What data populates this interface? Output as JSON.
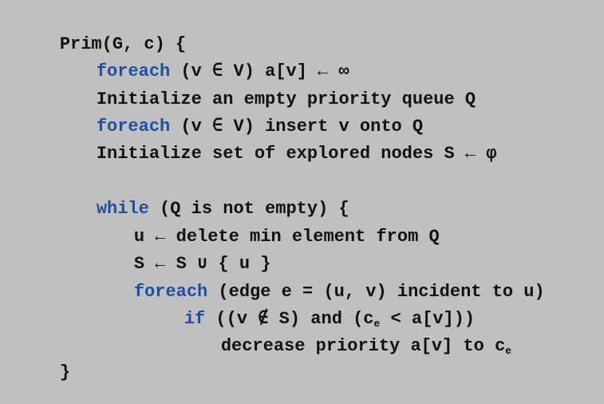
{
  "colors": {
    "background": "#c0c0c0",
    "text": "#111111",
    "keyword": "#1f4fa0"
  },
  "code": {
    "l1": {
      "text": "Prim(G, c) {"
    },
    "l2": {
      "kw": "foreach",
      "text": " (v ∈ V) a[v] ← ∞"
    },
    "l3": {
      "text": "Initialize an empty priority queue Q"
    },
    "l4": {
      "kw": "foreach",
      "text": " (v ∈ V) insert v onto Q"
    },
    "l5": {
      "text": "Initialize set of explored nodes S ← φ"
    },
    "l6": {
      "kw": "while",
      "text": " (Q is not empty) {"
    },
    "l7": {
      "text": "u ← delete min element from Q"
    },
    "l8": {
      "text": "S ← S ∪ { u }"
    },
    "l9": {
      "kw": "foreach",
      "text": " (edge e = (u, v) incident to u)"
    },
    "l10": {
      "kw": "if",
      "text_a": " ((v ∉ S) and (c",
      "sub": "e",
      "text_b": " < a[v]))"
    },
    "l11": {
      "text": "decrease priority a[v] to c",
      "sub": "e"
    },
    "l12": {
      "text": "}"
    }
  }
}
